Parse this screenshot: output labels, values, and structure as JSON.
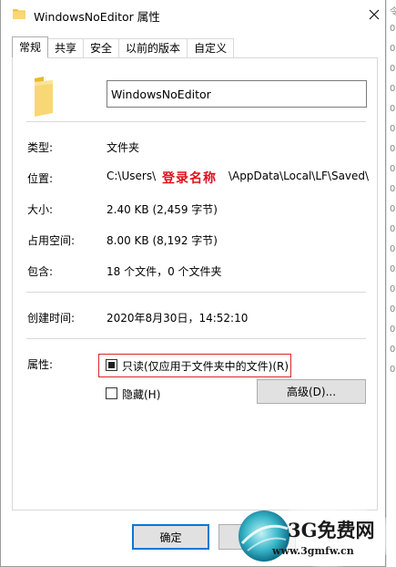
{
  "window": {
    "title": "WindowsNoEditor 属性",
    "close_glyph": "✕"
  },
  "tabs": [
    {
      "label": "常规",
      "active": true
    },
    {
      "label": "共享",
      "active": false
    },
    {
      "label": "安全",
      "active": false
    },
    {
      "label": "以前的版本",
      "active": false
    },
    {
      "label": "自定义",
      "active": false
    }
  ],
  "general": {
    "name": "WindowsNoEditor",
    "type_label": "类型:",
    "type_value": "文件夹",
    "location_label": "位置:",
    "location_prefix": "C:\\Users\\",
    "location_redacted": "登录名称",
    "location_suffix": "\\AppData\\Local\\LF\\Saved\\",
    "size_label": "大小:",
    "size_value": "2.40 KB (2,459 字节)",
    "disk_label": "占用空间:",
    "disk_value": "8.00 KB (8,192 字节)",
    "contains_label": "包含:",
    "contains_value": "18 个文件，0 个文件夹",
    "created_label": "创建时间:",
    "created_value": "2020年8月30日，14:52:10",
    "attributes_label": "属性:",
    "readonly_label": "只读(仅应用于文件夹中的文件)(R)",
    "readonly_state": "mixed",
    "hidden_label": "隐藏(H)",
    "hidden_checked": false,
    "advanced_label": "高级(D)..."
  },
  "footer": {
    "ok_label": "确定"
  },
  "background": {
    "strip_chars": [
      "令",
      "0",
      "0",
      "0",
      "0",
      "0",
      "0",
      "0",
      "0",
      "0",
      "0",
      "0",
      "0",
      "0",
      "0",
      "0",
      "0",
      "0",
      "0"
    ],
    "left_fragment": "18"
  },
  "watermark": {
    "text": "3G免费网",
    "url": "www.3gmfw.cn"
  },
  "colors": {
    "accent": "#0078d7",
    "highlight_box": "#d8262c",
    "redaction_text": "#e0101c",
    "folder_yellow": "#f8d775"
  }
}
